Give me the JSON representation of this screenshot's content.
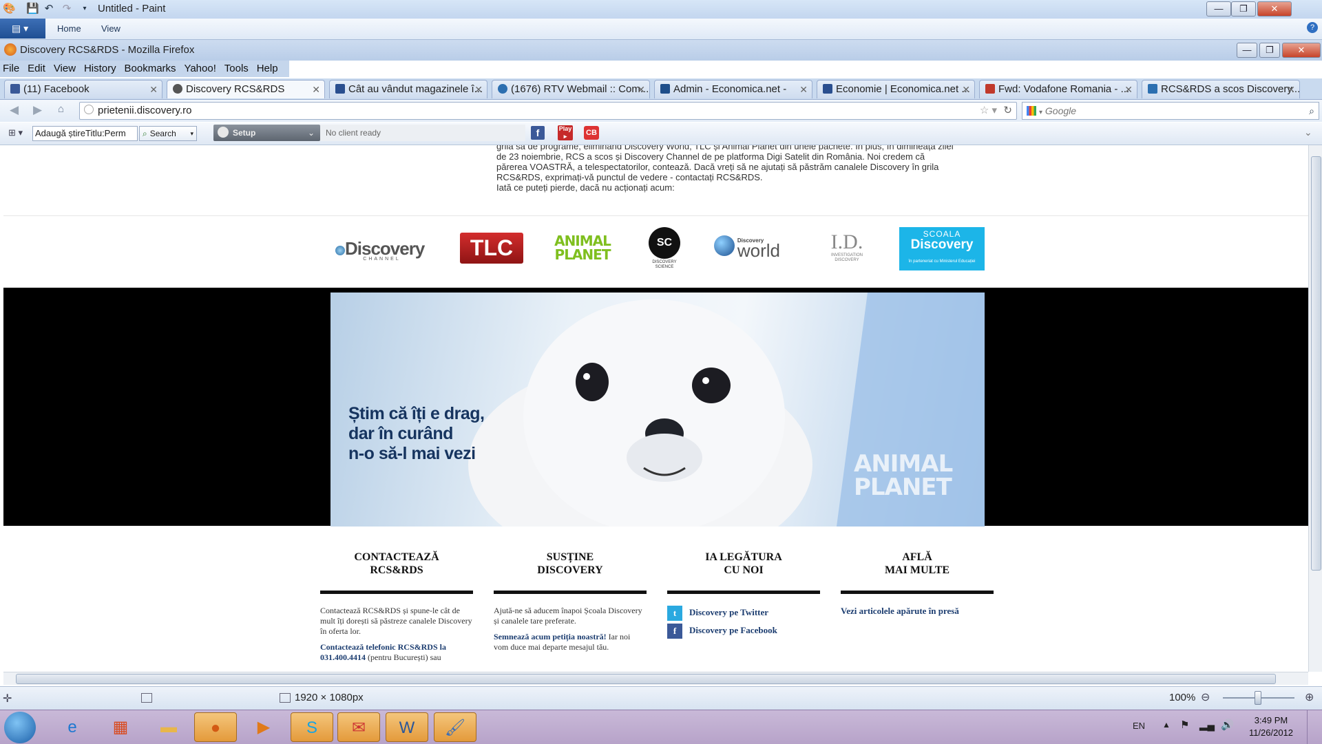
{
  "paint": {
    "title": "Untitled - Paint",
    "tabs": [
      "Home",
      "View"
    ],
    "status_size": "1920 × 1080px",
    "zoom": "100%"
  },
  "firefox": {
    "title": "Discovery RCS&RDS - Mozilla Firefox",
    "menu": [
      "File",
      "Edit",
      "View",
      "History",
      "Bookmarks",
      "Yahoo!",
      "Tools",
      "Help"
    ],
    "tabs": [
      {
        "label": "(11) Facebook",
        "icon_color": "#3b5998"
      },
      {
        "label": "Discovery RCS&RDS",
        "icon_color": "#555555"
      },
      {
        "label": "Cât au vândut magazinele î...",
        "icon_color": "#2a4f8f"
      },
      {
        "label": "(1676) RTV Webmail :: Com...",
        "icon_color": "#2c6fb0"
      },
      {
        "label": "Admin - Economica.net -",
        "icon_color": "#1f4f8a"
      },
      {
        "label": "Economie | Economica.net ...",
        "icon_color": "#2a4f8f"
      },
      {
        "label": "Fwd: Vodafone Romania - ...",
        "icon_color": "#c0392b"
      },
      {
        "label": "RCS&RDS a scos Discovery...",
        "icon_color": "#2c6fb0"
      }
    ],
    "url": "prietenii.discovery.ro",
    "search_placeholder": "Google",
    "toolbar2": {
      "dropdown_value": "Adaugă știreTitlu:Perm",
      "search_label": "Search",
      "setup_label": "Setup",
      "status": "No client ready"
    }
  },
  "page": {
    "intro_lines": [
      "grila sa de programe, eliminând Discovery World, TLC și Animal Planet din unele pachete. În plus, în dimineața zilei",
      "de 23 noiembrie, RCS a scos și Discovery Channel de pe platforma Digi Satelit din România. Noi credem că",
      "părerea VOASTRĂ, a telespectatorilor, contează. Dacă vreți să ne ajutați să păstrăm canalele Discovery în grila",
      "RCS&RDS, exprimați-vă punctul de vedere - contactați RCS&RDS.",
      "Iată ce puteți pierde, dacă nu acționați acum:"
    ],
    "logos": {
      "discovery": "Discovery",
      "discovery_sub": "CHANNEL",
      "tlc": "TLC",
      "animal_planet": "ANIMAL PLANET",
      "science": "SC",
      "science_sub": "DISCOVERY SCIENCE",
      "world_small": "Discovery",
      "world": "world",
      "id": "I.D.",
      "id_sub": "INVESTIGATION DISCOVERY",
      "scoala_top": "SCOALA",
      "scoala": "Discovery",
      "scoala_sub": "în parteneriat cu Ministerul Educației"
    },
    "hero": {
      "headline_1": "Știm că îți e drag,",
      "headline_2": "dar în curând",
      "headline_3": "n-o să-l mai vezi",
      "watermark": "ANIMAL PLANET"
    },
    "footer": [
      {
        "heading_1": "CONTACTEAZĂ",
        "heading_2": "RCS&RDS",
        "text": "Contactează RCS&RDS și spune-le cât de mult îți dorești să păstreze canalele Discovery în oferta lor.",
        "link": "Contactează telefonic RCS&RDS la 031.400.4414",
        "link_tail": " (pentru București) sau"
      },
      {
        "heading_1": "SUSȚINE",
        "heading_2": "DISCOVERY",
        "text": "Ajută-ne să aducem înapoi Școala Discovery și canalele tare preferate.",
        "link": "Semnează acum petiția noastră!",
        "link_tail": " Iar noi vom duce mai departe mesajul tău."
      },
      {
        "heading_1": "IA LEGĂTURA",
        "heading_2": "CU NOI",
        "twitter": "Discovery pe Twitter",
        "facebook": "Discovery pe Facebook"
      },
      {
        "heading_1": "AFLĂ",
        "heading_2": "MAI MULTE",
        "link": "Vezi articolele apărute în presă"
      }
    ]
  },
  "taskbar": {
    "language": "EN",
    "time": "3:49 PM",
    "date": "11/26/2012"
  }
}
